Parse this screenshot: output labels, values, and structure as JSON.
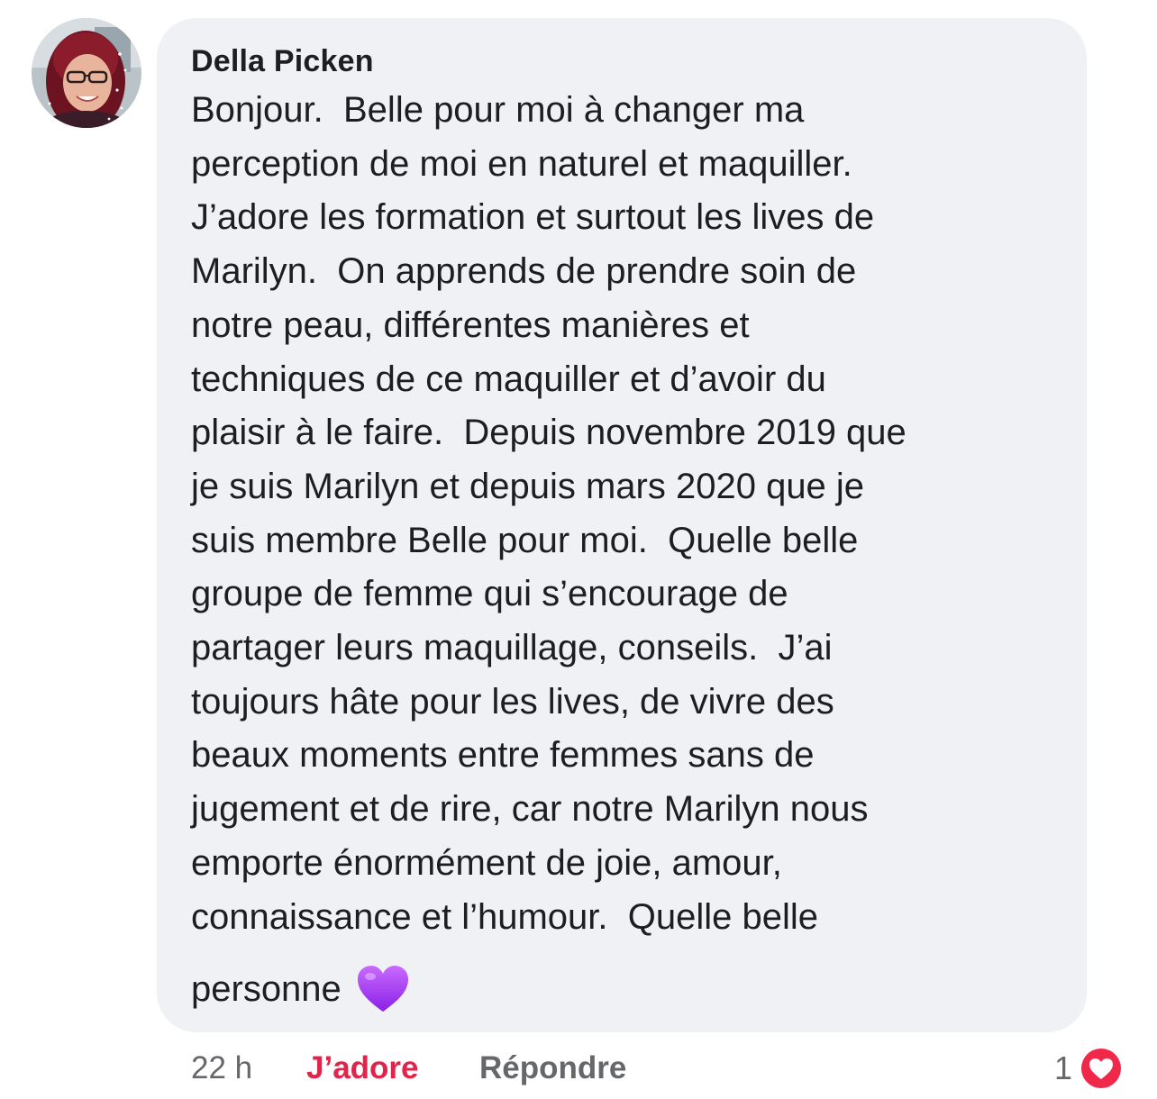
{
  "comment": {
    "author": "Della Picken",
    "text": "Bonjour.  Belle pour moi à changer ma\nperception de moi en naturel et maquiller.\nJ’adore les formation et surtout les lives de\nMarilyn.  On apprends de prendre soin de\nnotre peau, différentes manières et\ntechniques de ce maquiller et d’avoir du\nplaisir à le faire.  Depuis novembre 2019 que\nje suis Marilyn et depuis mars 2020 que je\nsuis membre Belle pour moi.  Quelle belle\ngroupe de femme qui s’encourage de\npartager leurs maquillage, conseils.  J’ai\ntoujours hâte pour les lives, de vivre des\nbeaux moments entre femmes sans de\njugement et de rire, car notre Marilyn nous\nemporte énormément de joie, amour,\nconnaissance et l’humour.  Quelle belle",
    "last_line": "personne",
    "emoji": "purple-heart",
    "bubble_color": "#eff1f4"
  },
  "actions": {
    "time": "22 h",
    "like_label": "J’adore",
    "like_color": "#e0244a",
    "reply_label": "Répondre"
  },
  "reactions": {
    "count": "1",
    "type": "love-icon"
  }
}
